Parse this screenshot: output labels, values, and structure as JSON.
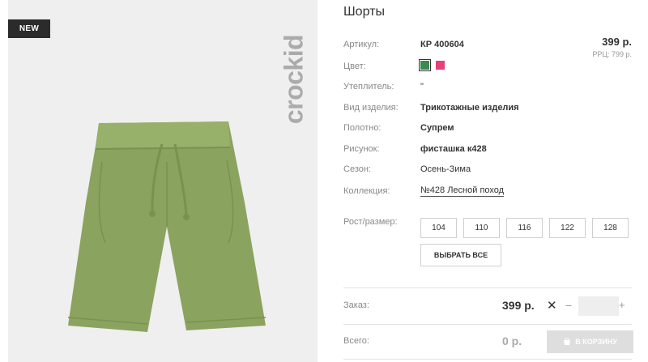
{
  "photo": {
    "badge": "NEW",
    "brand_logo": "crockid",
    "product_icon": "green-shorts-image"
  },
  "product": {
    "title": "Шорты",
    "price": "399 р.",
    "rrp": "РРЦ: 799 р.",
    "rows": {
      "article": {
        "label": "Артикул:",
        "value": "КР 400604"
      },
      "color": {
        "label": "Цвет:",
        "swatches": [
          "#3a8a52",
          "#e8407a"
        ]
      },
      "insulation": {
        "label": "Утеплитель:",
        "value": "\""
      },
      "type": {
        "label": "Вид изделия:",
        "value": "Трикотажные изделия"
      },
      "fabric": {
        "label": "Полотно:",
        "value": "Супрем"
      },
      "print": {
        "label": "Рисунок:",
        "value": "фисташка к428"
      },
      "season": {
        "label": "Сезон:",
        "value": "Осень-Зима"
      },
      "collection": {
        "label": "Коллекция:",
        "value": "№428 Лесной поход"
      }
    },
    "size_label": "Рост/размер:",
    "sizes": [
      "104",
      "110",
      "116",
      "122",
      "128"
    ],
    "select_all": "ВЫБРАТЬ ВСЕ"
  },
  "order": {
    "label": "Заказ:",
    "price": "399 р.",
    "times": "✕",
    "minus": "−",
    "plus": "+",
    "qty": ""
  },
  "total": {
    "label": "Всего:",
    "value": "0 р.",
    "cart_button": "В КОРЗИНУ"
  },
  "colors": {
    "badge_bg": "#2b2b2b",
    "product_green": "#8aa35e",
    "cart_disabled": "#dedede"
  }
}
